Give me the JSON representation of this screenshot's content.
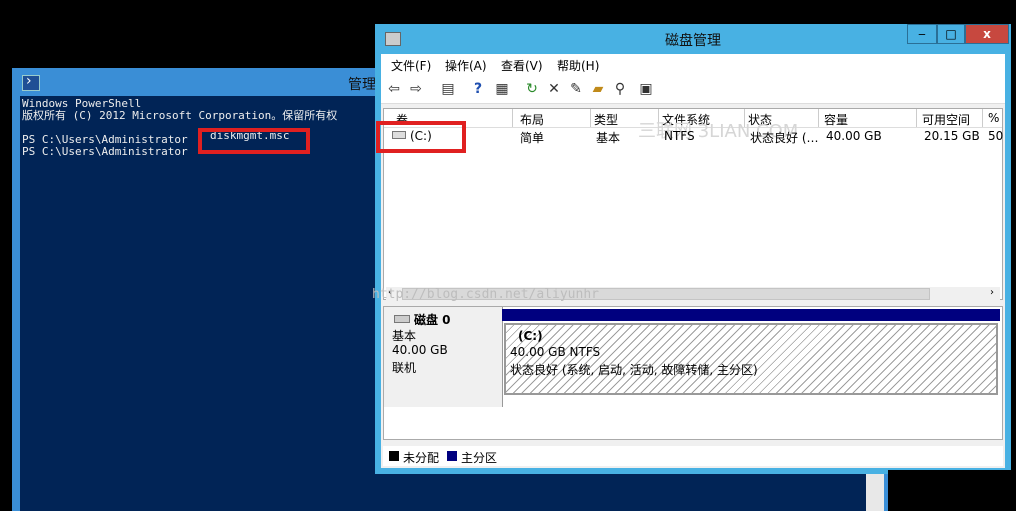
{
  "powershell": {
    "title": "管理",
    "lines": [
      "Windows PowerShell",
      "版权所有 (C) 2012 Microsoft Corporation。保留所有权",
      "",
      "PS C:\\Users\\Administrator",
      "PS C:\\Users\\Administrator"
    ],
    "command": "diskmgmt.msc"
  },
  "disk_mgmt": {
    "title": "磁盘管理",
    "window_buttons": {
      "minimize": "‒",
      "maximize": "□",
      "close": "x"
    },
    "menu": [
      "文件(F)",
      "操作(A)",
      "查看(V)",
      "帮助(H)"
    ],
    "toolbar_icons": [
      "back-icon",
      "forward-icon",
      "list-icon",
      "help-icon",
      "properties-icon",
      "refresh-icon",
      "delete-icon",
      "settings-icon",
      "open-icon",
      "search-icon",
      "disk-icon"
    ],
    "watermark": "三联网 3LIAN.COM",
    "url_watermark": "http://blog.csdn.net/aliyunhr",
    "columns": [
      "卷",
      "布局",
      "类型",
      "文件系统",
      "状态",
      "容量",
      "可用空间",
      "%"
    ],
    "volumes": [
      {
        "name": "(C:)",
        "layout": "简单",
        "type": "基本",
        "fs": "NTFS",
        "status": "状态良好 (…",
        "capacity": "40.00 GB",
        "free": "20.15 GB",
        "pct": "50"
      }
    ],
    "disk": {
      "name": "磁盘 0",
      "type": "基本",
      "size": "40.00 GB",
      "state": "联机",
      "partition_label": "(C:)",
      "partition_size": "40.00 GB NTFS",
      "partition_status": "状态良好 (系统, 启动, 活动, 故障转储, 主分区)"
    },
    "legend": [
      {
        "label": "未分配",
        "color": "#000000"
      },
      {
        "label": "主分区",
        "color": "#00007f"
      }
    ]
  }
}
